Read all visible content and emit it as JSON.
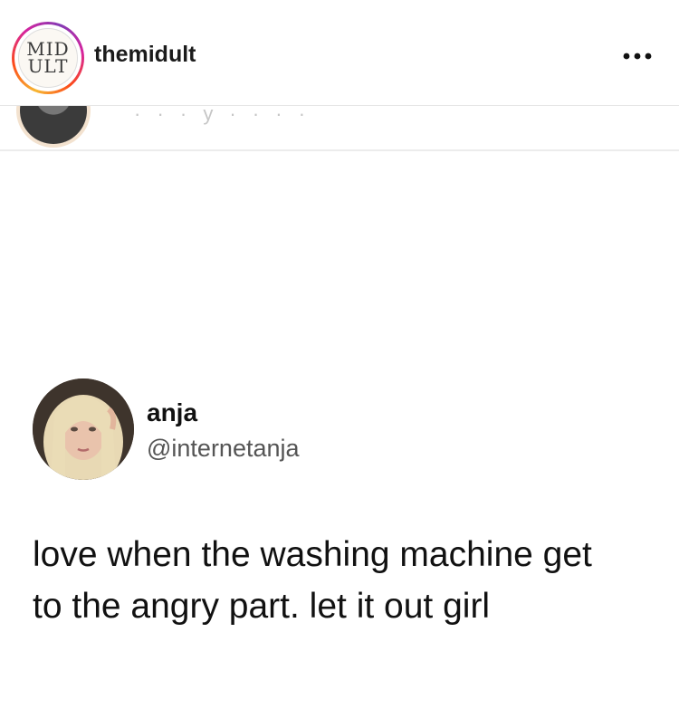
{
  "header": {
    "logo_lines": [
      "MID",
      "ULT"
    ],
    "username": "themidult",
    "more_icon": "more-horizontal-icon"
  },
  "tweet": {
    "name": "anja",
    "handle": "@internetanja",
    "text_lines": [
      "love when the washing machine get",
      "to the angry part. let it out girl"
    ]
  }
}
